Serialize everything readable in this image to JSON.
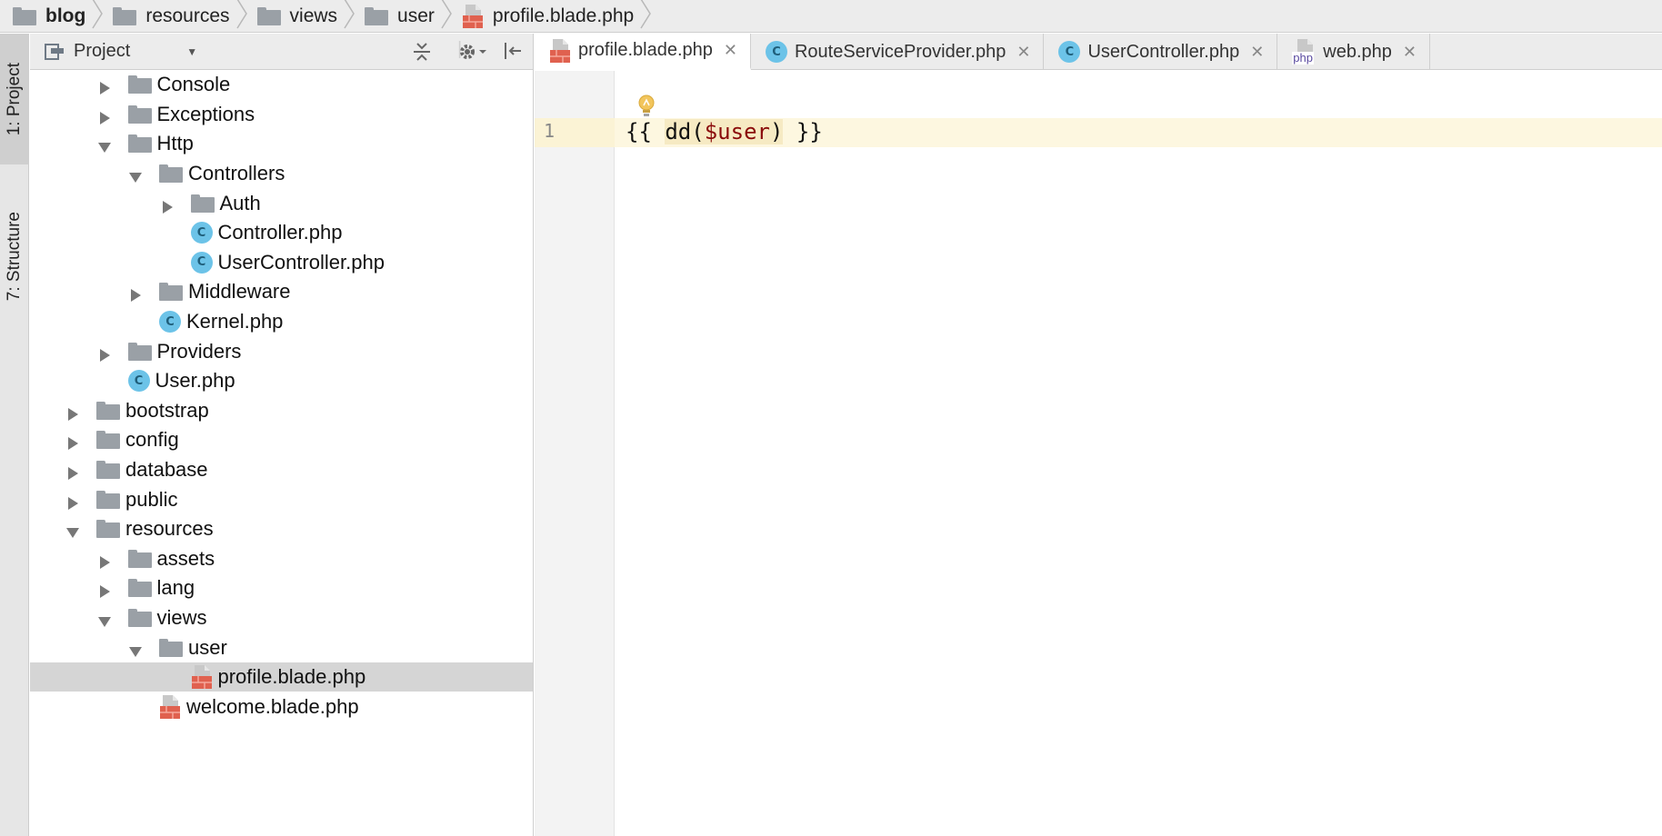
{
  "breadcrumb": [
    {
      "label": "blog",
      "icon": "folder-icon",
      "bold": true
    },
    {
      "label": "resources",
      "icon": "folder-icon"
    },
    {
      "label": "views",
      "icon": "folder-icon"
    },
    {
      "label": "user",
      "icon": "folder-icon"
    },
    {
      "label": "profile.blade.php",
      "icon": "blade-file-icon"
    }
  ],
  "stripe": {
    "project_label": "1: Project",
    "structure_label": "7: Structure"
  },
  "project_panel": {
    "title": "Project",
    "tree": [
      {
        "label": "Console",
        "icon": "folder",
        "depth": 2,
        "state": "collapsed"
      },
      {
        "label": "Exceptions",
        "icon": "folder",
        "depth": 2,
        "state": "collapsed"
      },
      {
        "label": "Http",
        "icon": "folder",
        "depth": 2,
        "state": "expanded"
      },
      {
        "label": "Controllers",
        "icon": "folder",
        "depth": 3,
        "state": "expanded"
      },
      {
        "label": "Auth",
        "icon": "folder",
        "depth": 4,
        "state": "collapsed"
      },
      {
        "label": "Controller.php",
        "icon": "class",
        "depth": 4,
        "state": "leaf"
      },
      {
        "label": "UserController.php",
        "icon": "class",
        "depth": 4,
        "state": "leaf"
      },
      {
        "label": "Middleware",
        "icon": "folder",
        "depth": 3,
        "state": "collapsed"
      },
      {
        "label": "Kernel.php",
        "icon": "class",
        "depth": 3,
        "state": "leaf"
      },
      {
        "label": "Providers",
        "icon": "folder",
        "depth": 2,
        "state": "collapsed"
      },
      {
        "label": "User.php",
        "icon": "class",
        "depth": 2,
        "state": "leaf"
      },
      {
        "label": "bootstrap",
        "icon": "folder",
        "depth": 1,
        "state": "collapsed"
      },
      {
        "label": "config",
        "icon": "folder",
        "depth": 1,
        "state": "collapsed"
      },
      {
        "label": "database",
        "icon": "folder",
        "depth": 1,
        "state": "collapsed"
      },
      {
        "label": "public",
        "icon": "folder",
        "depth": 1,
        "state": "collapsed"
      },
      {
        "label": "resources",
        "icon": "folder",
        "depth": 1,
        "state": "expanded"
      },
      {
        "label": "assets",
        "icon": "folder",
        "depth": 2,
        "state": "collapsed"
      },
      {
        "label": "lang",
        "icon": "folder",
        "depth": 2,
        "state": "collapsed"
      },
      {
        "label": "views",
        "icon": "folder",
        "depth": 2,
        "state": "expanded"
      },
      {
        "label": "user",
        "icon": "folder",
        "depth": 3,
        "state": "expanded"
      },
      {
        "label": "profile.blade.php",
        "icon": "blade",
        "depth": 4,
        "state": "leaf",
        "selected": true
      },
      {
        "label": "welcome.blade.php",
        "icon": "blade",
        "depth": 3,
        "state": "leaf"
      }
    ]
  },
  "editor": {
    "tabs": [
      {
        "label": "profile.blade.php",
        "icon": "blade-file-icon",
        "active": true
      },
      {
        "label": "RouteServiceProvider.php",
        "icon": "class-icon"
      },
      {
        "label": "UserController.php",
        "icon": "class-icon"
      },
      {
        "label": "web.php",
        "icon": "php-file-icon"
      }
    ],
    "line_number": "1",
    "code": {
      "open": "{{ ",
      "fn_open": "dd(",
      "var": "$user",
      "fn_close": ")",
      "close": " }}"
    }
  },
  "icons": {
    "class_letter": "C",
    "php_badge": "php"
  },
  "colors": {
    "class_icon": "#6cc3e8",
    "blade_icon": "#e0614f",
    "var": "#8a0a0a",
    "current_line": "#fdf7e0"
  }
}
